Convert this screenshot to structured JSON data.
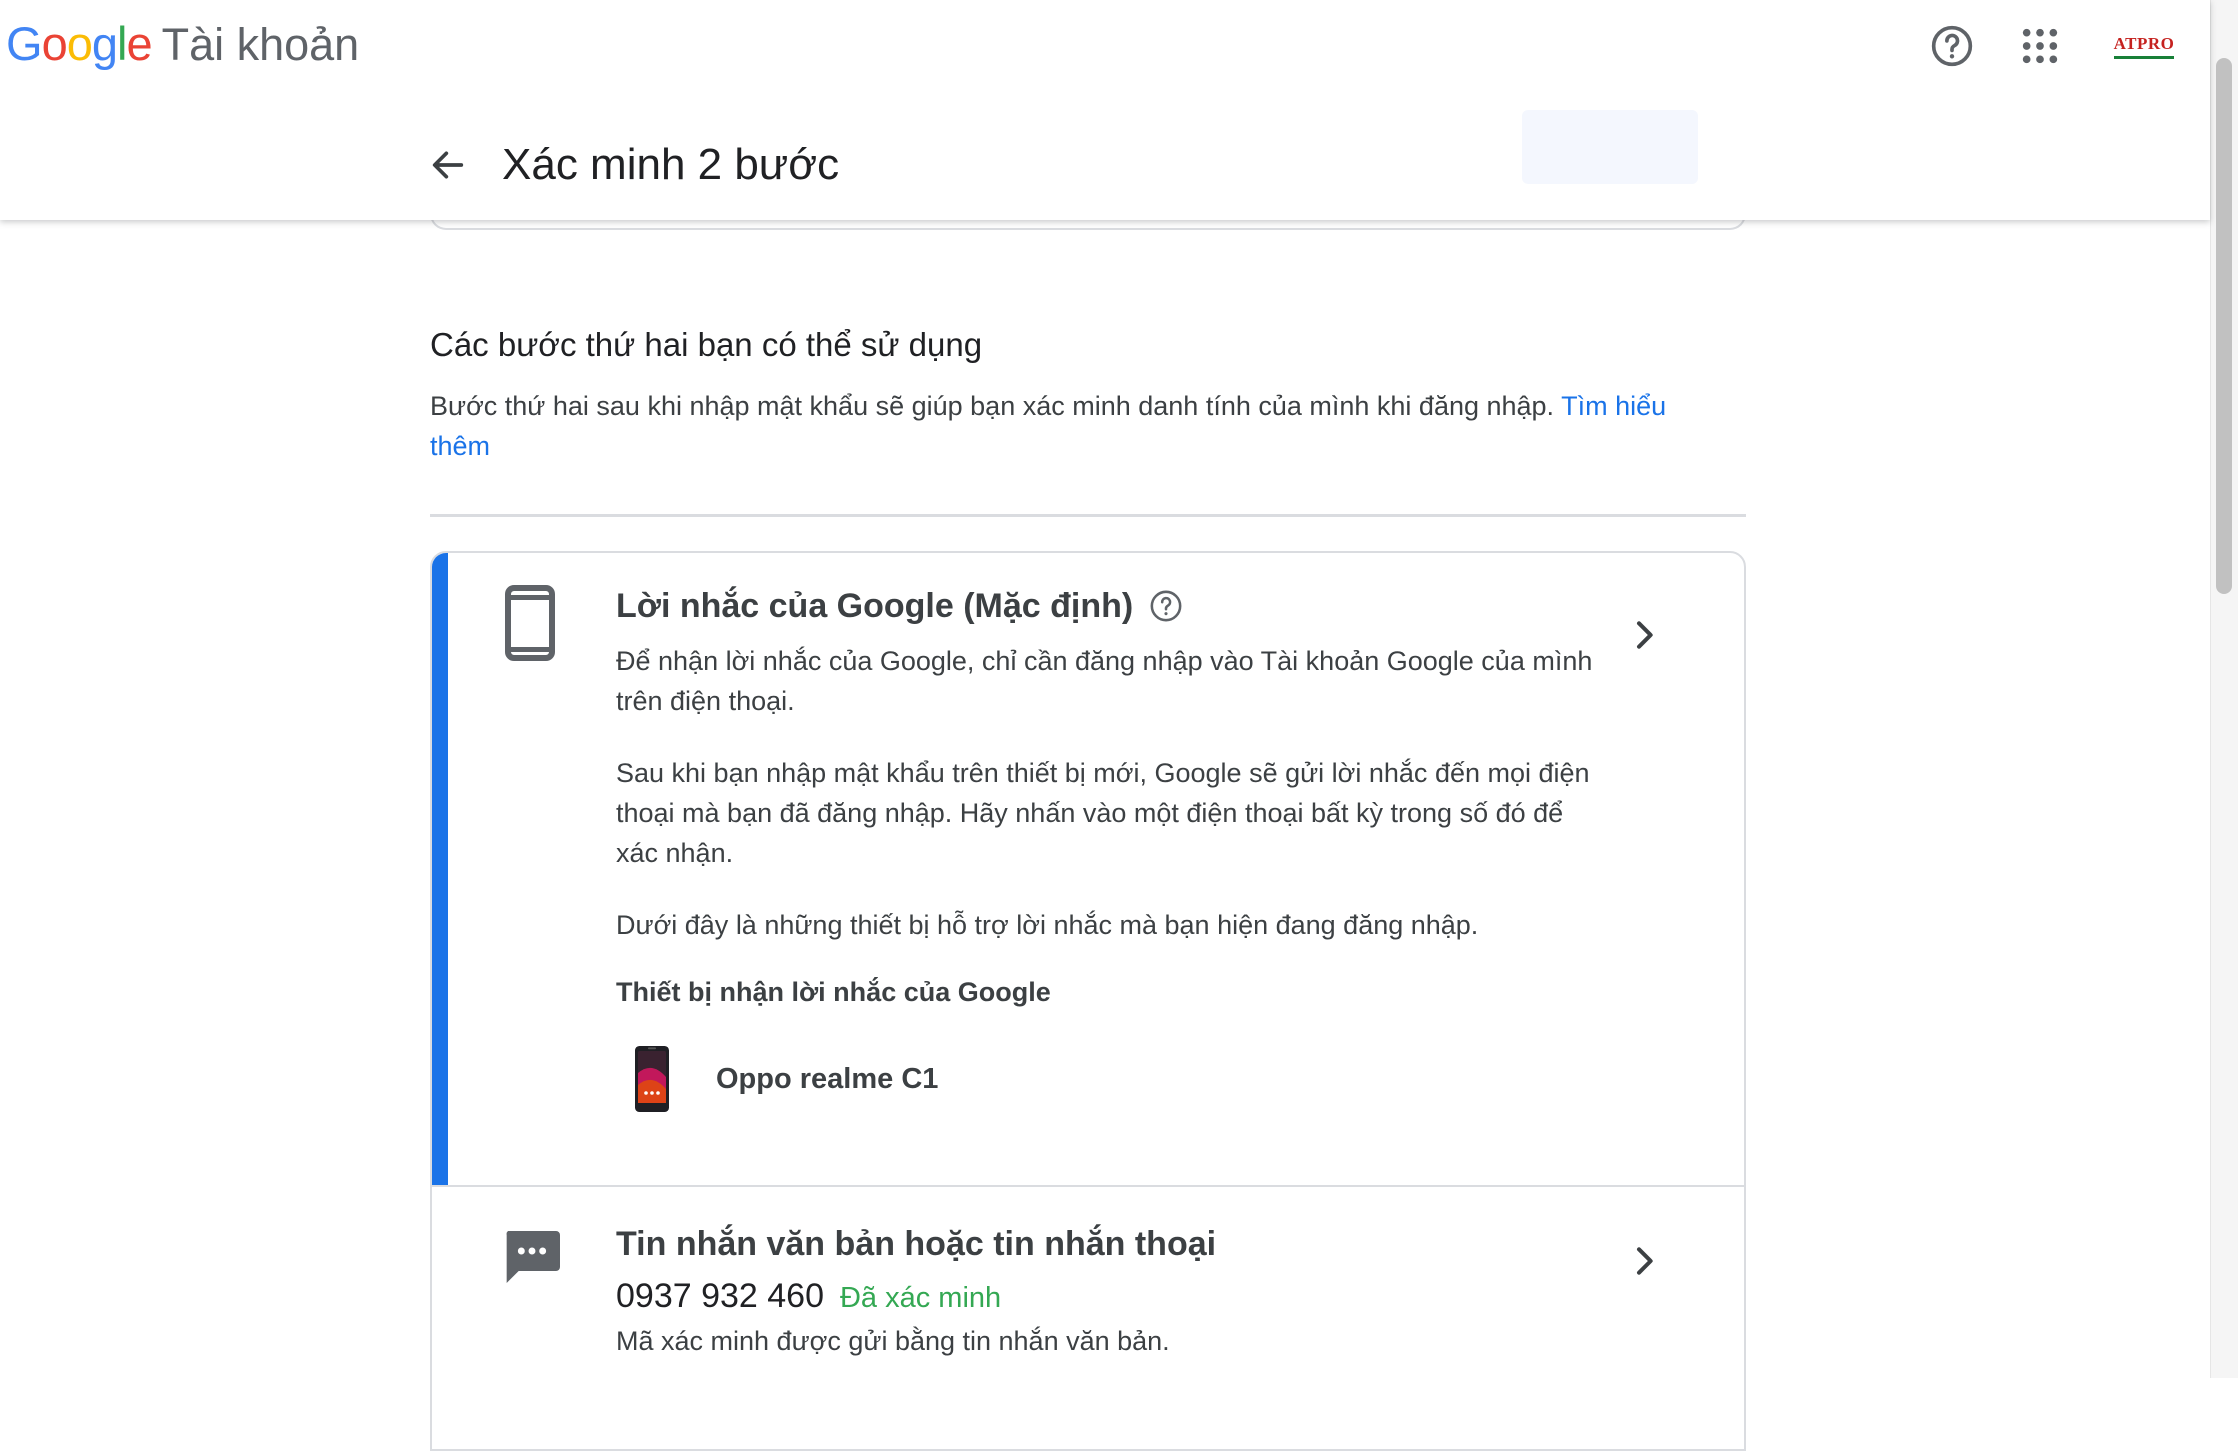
{
  "header": {
    "logo_letters": [
      {
        "char": "G",
        "color": "#4285F4"
      },
      {
        "char": "o",
        "color": "#EA4335"
      },
      {
        "char": "o",
        "color": "#FBBC05"
      },
      {
        "char": "g",
        "color": "#4285F4"
      },
      {
        "char": "l",
        "color": "#34A853"
      },
      {
        "char": "e",
        "color": "#EA4335"
      }
    ],
    "product_name": "Tài khoản",
    "help_icon": "help-circle-icon",
    "apps_icon": "apps-grid-icon",
    "account_badge": "ATPRO"
  },
  "subheader": {
    "title": "Xác minh 2 bước",
    "back_icon": "arrow-back-icon"
  },
  "section": {
    "title": "Các bước thứ hai bạn có thể sử dụng",
    "description": "Bước thứ hai sau khi nhập mật khẩu sẽ giúp bạn xác minh danh tính của mình khi đăng nhập.",
    "learn_more": "Tìm hiểu thêm"
  },
  "methods": {
    "prompt": {
      "title": "Lời nhắc của Google (Mặc định)",
      "icon": "smartphone-icon",
      "paragraph1": "Để nhận lời nhắc của Google, chỉ cần đăng nhập vào Tài khoản Google của mình trên điện thoại.",
      "paragraph2": "Sau khi bạn nhập mật khẩu trên thiết bị mới, Google sẽ gửi lời nhắc đến mọi điện thoại mà bạn đã đăng nhập. Hãy nhấn vào một điện thoại bất kỳ trong số đó để xác nhận.",
      "paragraph3": "Dưới đây là những thiết bị hỗ trợ lời nhắc mà bạn hiện đang đăng nhập.",
      "devices_heading": "Thiết bị nhận lời nhắc của Google",
      "devices": [
        {
          "name": "Oppo realme C1"
        }
      ],
      "accent_color": "#1a73e8"
    },
    "sms": {
      "title": "Tin nhắn văn bản hoặc tin nhắn thoại",
      "icon": "sms-icon",
      "phone": "0937 932 460",
      "status": "Đã xác minh",
      "status_color": "#34a853",
      "description": "Mã xác minh được gửi bằng tin nhắn văn bản."
    }
  }
}
